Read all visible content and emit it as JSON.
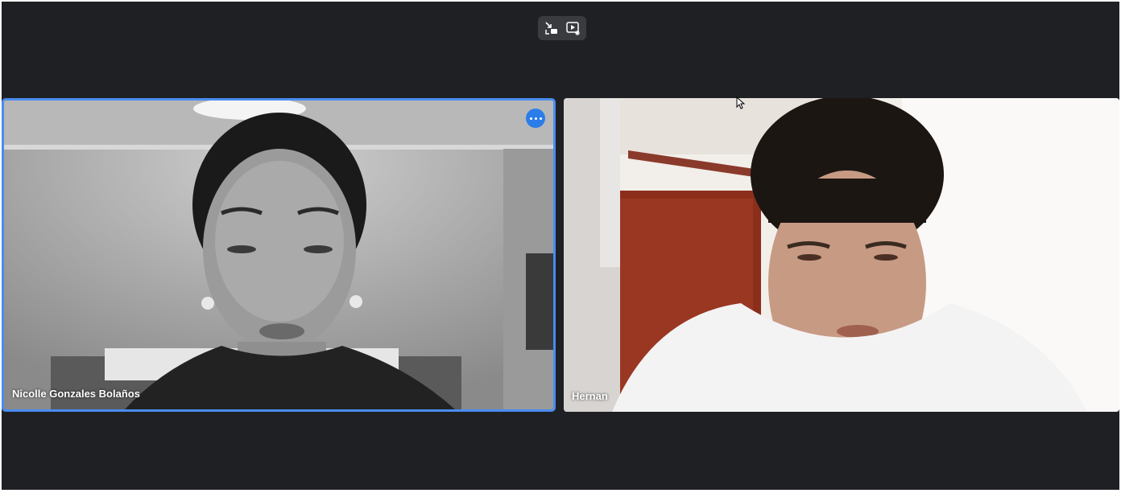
{
  "toolbar": {
    "buttons": [
      {
        "icon": "exit-fullscreen-icon"
      },
      {
        "icon": "video-effects-icon"
      }
    ]
  },
  "participants": [
    {
      "name": "Nicolle Gonzales Bolaños",
      "active_speaker": true
    },
    {
      "name": "Hernan",
      "active_speaker": false
    }
  ],
  "colors": {
    "background": "#1f2023",
    "active_border": "#4a8cf0",
    "more_button": "#2b7de9"
  }
}
